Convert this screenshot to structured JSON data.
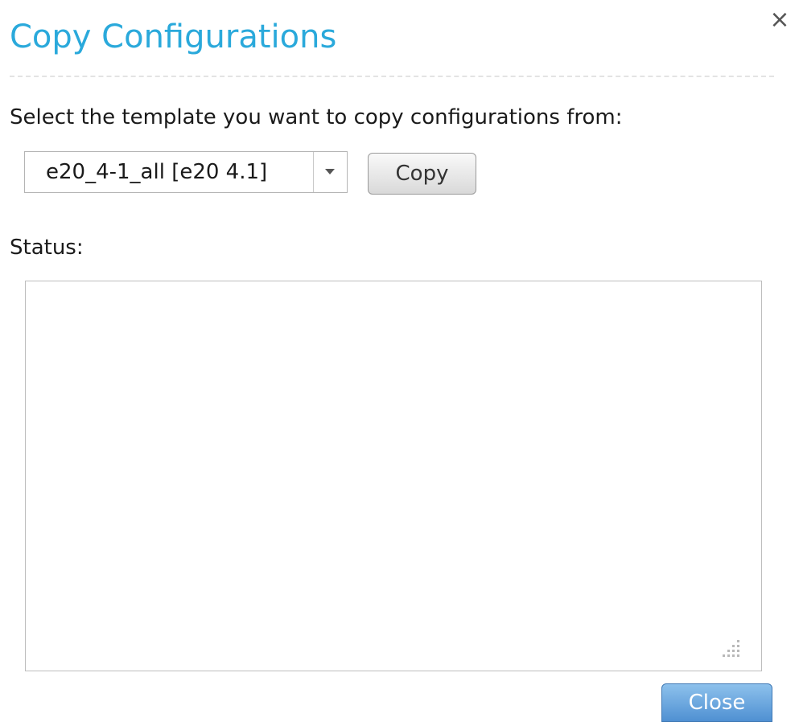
{
  "dialog": {
    "title": "Copy Configurations",
    "close_icon": "close-icon",
    "close_glyph": "×"
  },
  "form": {
    "prompt": "Select the template you want to copy configurations from:",
    "template_select": {
      "selected_value": "e20_4-1_all [e20 4.1]",
      "arrow_icon": "chevron-down-icon"
    },
    "copy_button_label": "Copy",
    "status_label": "Status:",
    "status_text": ""
  },
  "footer": {
    "close_button_label": "Close"
  },
  "colors": {
    "title": "#2aa9db",
    "primary_button": "#4f90d2",
    "text": "#1a1a1a"
  }
}
